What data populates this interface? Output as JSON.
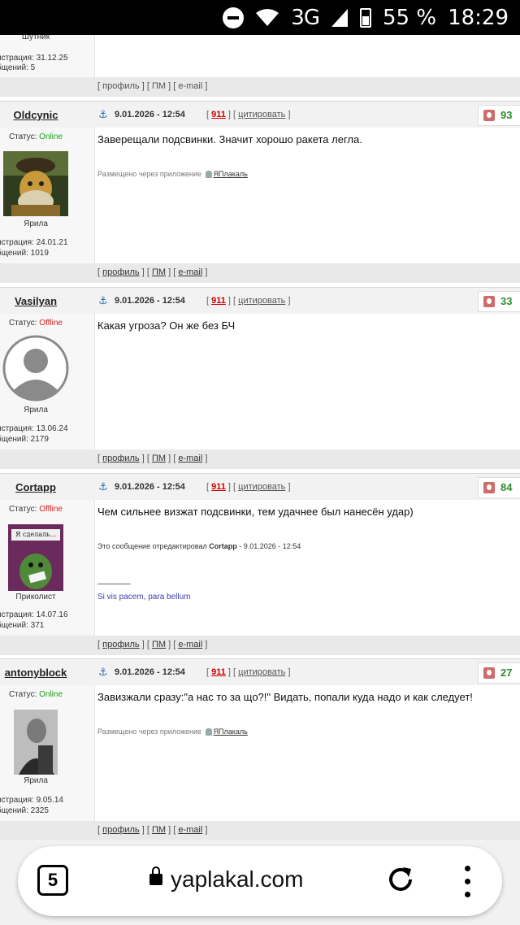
{
  "status_bar": {
    "network": "3G",
    "battery": "55 %",
    "time": "18:29"
  },
  "top_fragment": {
    "rank": "Шутник",
    "reg": "истрация: 31.12.25",
    "count": "бщений: 5"
  },
  "footer_links": {
    "profile": "профиль",
    "pm": "ПМ",
    "email": "e-mail"
  },
  "posts": [
    {
      "username": "Oldcynic",
      "status_label": "Статус:",
      "status": "Online",
      "date": "9.01.2026 - 12:54",
      "n911": "911",
      "quote": "цитировать",
      "rating": "93",
      "rank": "Ярила",
      "reg": "истрация: 24.01.21",
      "count": "бщений: 1019",
      "text": "Заверещали подсвинки. Значит хорошо ракета легла.",
      "via": "Размещено через приложение",
      "app": "ЯПлакаль"
    },
    {
      "username": "Vasilyan",
      "status_label": "Статус:",
      "status": "Offline",
      "date": "9.01.2026 - 12:54",
      "n911": "911",
      "quote": "цитировать",
      "rating": "33",
      "rank": "Ярила",
      "reg": "истрация: 13.06.24",
      "count": "бщений: 2179",
      "text": "Какая угроза? Он же без БЧ"
    },
    {
      "username": "Cortapp",
      "status_label": "Статус:",
      "status": "Offline",
      "date": "9.01.2026 - 12:54",
      "n911": "911",
      "quote": "цитировать",
      "rating": "84",
      "rank": "Приколист",
      "reg": "истрация: 14.07.16",
      "count": "бщений: 371",
      "text": "Чем сильнее визжат подсвинки, тем удачнее был нанесён удар)",
      "edited_prefix": "Это сообщение отредактировал",
      "edited_user": "Cortapp",
      "edited_suffix": "- 9.01.2026 - 12:54",
      "sigline": "--------------------",
      "signature": "Si vis pacem, para bellum",
      "avatar_text": "Я сделаль..."
    },
    {
      "username": "antonyblock",
      "status_label": "Статус:",
      "status": "Online",
      "date": "9.01.2026 - 12:54",
      "n911": "911",
      "quote": "цитировать",
      "rating": "27",
      "rank": "Ярила",
      "reg": "истрация: 9.05.14",
      "count": "бщений: 2325",
      "text": "Завизжали сразу:\"а нас то за що?!\" Видать, попали куда надо и как следует!",
      "via": "Размещено через приложение",
      "app": "ЯПлакаль"
    }
  ],
  "browser": {
    "tabs_count": "5",
    "url": "yaplakal.com"
  }
}
